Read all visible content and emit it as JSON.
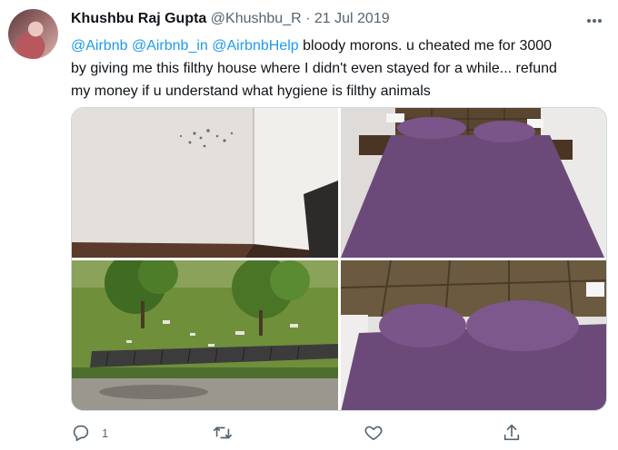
{
  "tweet": {
    "author_name": "Khushbu Raj Gupta",
    "author_handle": "@Khushbu_R",
    "separator": "·",
    "date": "21 Jul 2019",
    "mentions": [
      "@Airbnb",
      "@Airbnb_in",
      "@AirbnbHelp"
    ],
    "body_line1_rest": "bloody morons. u cheated me for 3000",
    "body_line2": "by giving me this filthy house where I didn't even stayed for a while... refund",
    "body_line3": "my money if u understand what hygiene is filthy animals"
  },
  "actions": {
    "reply_count": "1",
    "retweet_count": "",
    "like_count": "",
    "share_label": ""
  },
  "colors": {
    "mention": "#1d9bf0",
    "secondary_text": "#536471",
    "bedsheet": "#6b4a7a"
  },
  "icons": [
    "more-icon",
    "reply-icon",
    "retweet-icon",
    "like-icon",
    "share-icon"
  ]
}
